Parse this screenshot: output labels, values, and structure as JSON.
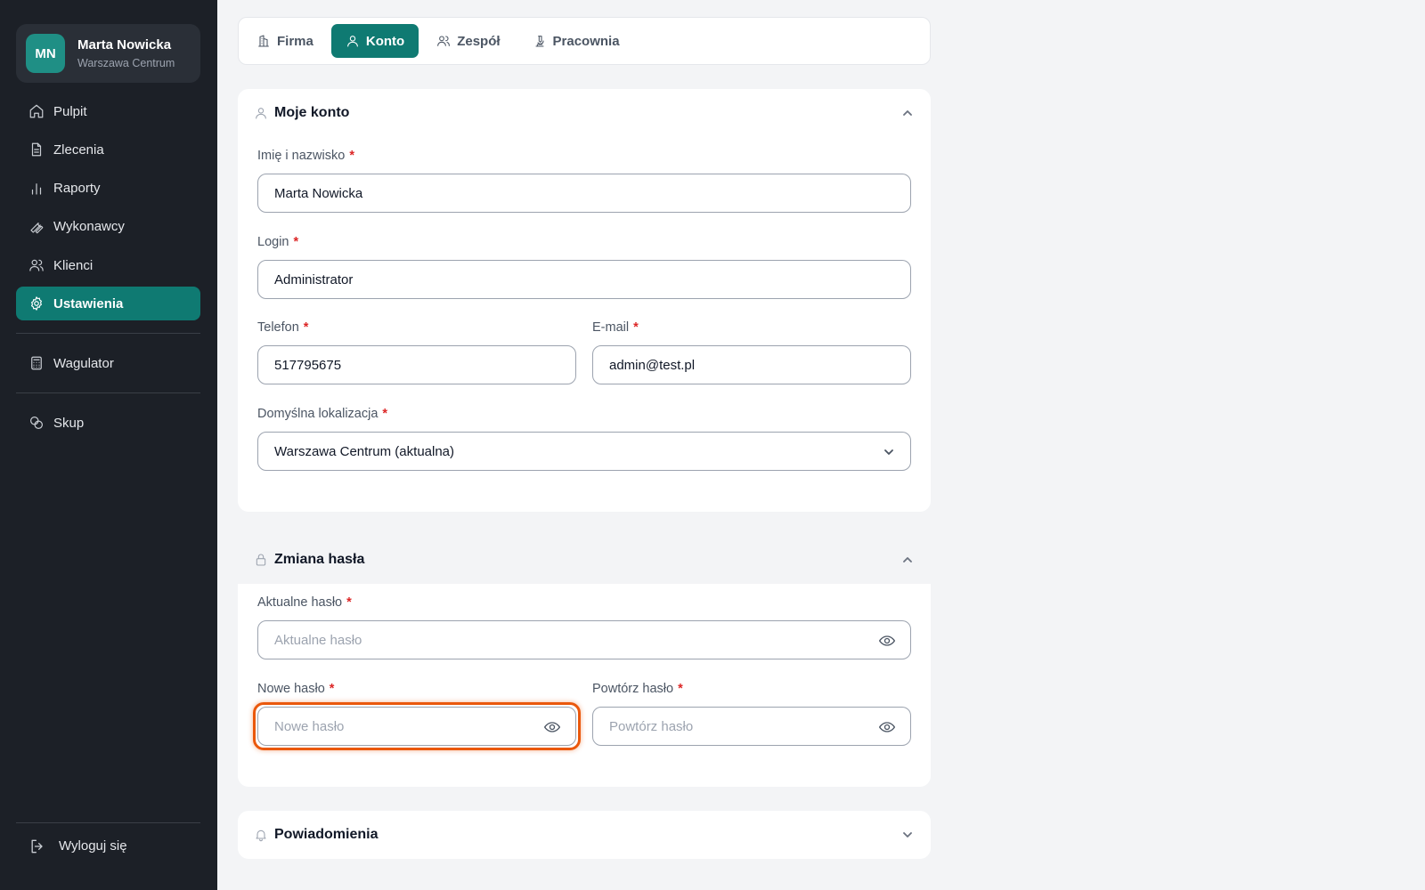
{
  "user": {
    "initials": "MN",
    "name": "Marta Nowicka",
    "location": "Warszawa Centrum"
  },
  "nav": {
    "items": [
      {
        "label": "Pulpit",
        "icon": "home-icon"
      },
      {
        "label": "Zlecenia",
        "icon": "document-icon"
      },
      {
        "label": "Raporty",
        "icon": "bar-chart-icon"
      },
      {
        "label": "Wykonawcy",
        "icon": "wrench-icon"
      },
      {
        "label": "Klienci",
        "icon": "users-icon"
      },
      {
        "label": "Ustawienia",
        "icon": "gear-icon",
        "active": true
      }
    ],
    "extra1": {
      "label": "Wagulator",
      "icon": "calculator-icon"
    },
    "extra2": {
      "label": "Skup",
      "icon": "coins-icon"
    },
    "logout": "Wyloguj się"
  },
  "tabs": [
    {
      "label": "Firma",
      "icon": "building-icon"
    },
    {
      "label": "Konto",
      "icon": "user-icon",
      "active": true
    },
    {
      "label": "Zespół",
      "icon": "users-icon"
    },
    {
      "label": "Pracownia",
      "icon": "microscope-icon"
    }
  ],
  "account": {
    "title": "Moje konto",
    "name_label": "Imię i nazwisko",
    "name_value": "Marta Nowicka",
    "login_label": "Login",
    "login_value": "Administrator",
    "phone_label": "Telefon",
    "phone_value": "517795675",
    "email_label": "E-mail",
    "email_value": "admin@test.pl",
    "location_label": "Domyślna lokalizacja",
    "location_value": "Warszawa Centrum (aktualna)"
  },
  "password": {
    "title": "Zmiana hasła",
    "current_label": "Aktualne hasło",
    "current_placeholder": "Aktualne hasło",
    "new_label": "Nowe hasło",
    "new_placeholder": "Nowe hasło",
    "repeat_label": "Powtórz hasło",
    "repeat_placeholder": "Powtórz hasło"
  },
  "notifications": {
    "title": "Powiadomienia"
  },
  "required_mark": "*",
  "colors": {
    "sidebar": "#1c2027",
    "accent": "#0f7a72",
    "focus": "#ea580c",
    "required": "#dc2626"
  }
}
